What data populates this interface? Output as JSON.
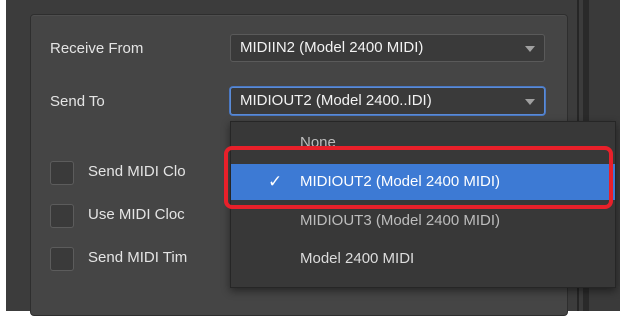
{
  "settings": {
    "receive_from": {
      "label": "Receive From",
      "value": "MIDIIN2 (Model 2400 MIDI)"
    },
    "send_to": {
      "label": "Send To",
      "value": "MIDIOUT2 (Model 2400..IDI)"
    },
    "checkboxes": [
      {
        "label": "Send MIDI Clo",
        "checked": false
      },
      {
        "label": "Use MIDI Cloc",
        "checked": false
      },
      {
        "label": "Send MIDI Tim",
        "checked": false
      }
    ]
  },
  "dropdown": {
    "options": [
      {
        "label": "None",
        "selected": false
      },
      {
        "label": "MIDIOUT2 (Model 2400 MIDI)",
        "selected": true
      },
      {
        "label": "MIDIOUT3 (Model 2400 MIDI)",
        "selected": false
      },
      {
        "label": "Model 2400 MIDI",
        "selected": false
      }
    ],
    "check_glyph": "✓"
  },
  "colors": {
    "panel": "#454545",
    "selection": "#3d7ad4",
    "highlight": "#e8202a"
  }
}
